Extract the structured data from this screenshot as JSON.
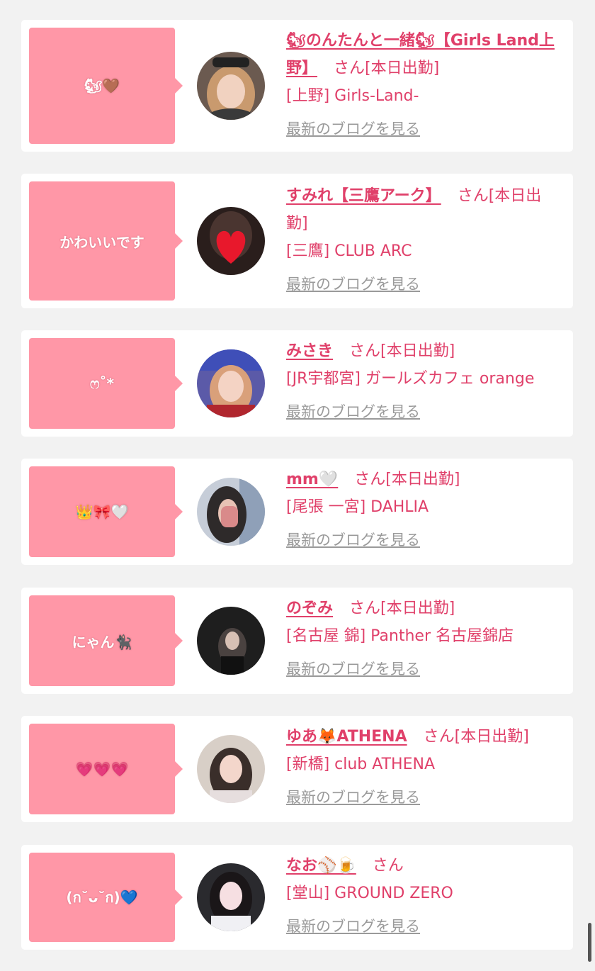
{
  "colors": {
    "page_bg": "#f2f2f2",
    "card_bg": "#ffffff",
    "bubble_bg": "#ff97a7",
    "accent_pink": "#e0406a",
    "link_gray": "#9a9a9a"
  },
  "cards": [
    {
      "bubble": "🐿🤎",
      "name": "🐿のんたんと一緒🐿【Girls Land上野】",
      "san": "さん",
      "status": "[本日出勤]",
      "shop": "[上野] Girls-Land-",
      "blog_link": "最新のブログを見る"
    },
    {
      "bubble": "かわいいです",
      "name": "すみれ【三鷹アーク】",
      "san": "さん",
      "status": "[本日出勤]",
      "shop": "[三鷹] CLUB ARC",
      "blog_link": "最新のブログを見る"
    },
    {
      "bubble": "ෆ˚*",
      "name": "みさき",
      "san": "さん",
      "status": "[本日出勤]",
      "shop": "[JR宇都宮] ガールズカフェ orange",
      "blog_link": "最新のブログを見る"
    },
    {
      "bubble": "👑🎀🤍",
      "name": "mm🤍",
      "san": "さん",
      "status": "[本日出勤]",
      "shop": "[尾張 一宮] DAHLIA",
      "blog_link": "最新のブログを見る"
    },
    {
      "bubble": "にゃん🐈‍⬛",
      "name": "のぞみ",
      "san": "さん",
      "status": "[本日出勤]",
      "shop": "[名古屋 錦] Panther 名古屋錦店",
      "blog_link": "最新のブログを見る"
    },
    {
      "bubble": "💗💗💗",
      "name": "ゆあ🦊ATHENA",
      "san": "さん",
      "status": "[本日出勤]",
      "shop": "[新橋] club ATHENA",
      "blog_link": "最新のブログを見る"
    },
    {
      "bubble": "(ก˘ᴗ˘ก)💙",
      "name": "なお⚾️🍺",
      "san": "さん",
      "status": "",
      "shop": "[堂山] GROUND ZERO",
      "blog_link": "最新のブログを見る"
    }
  ]
}
